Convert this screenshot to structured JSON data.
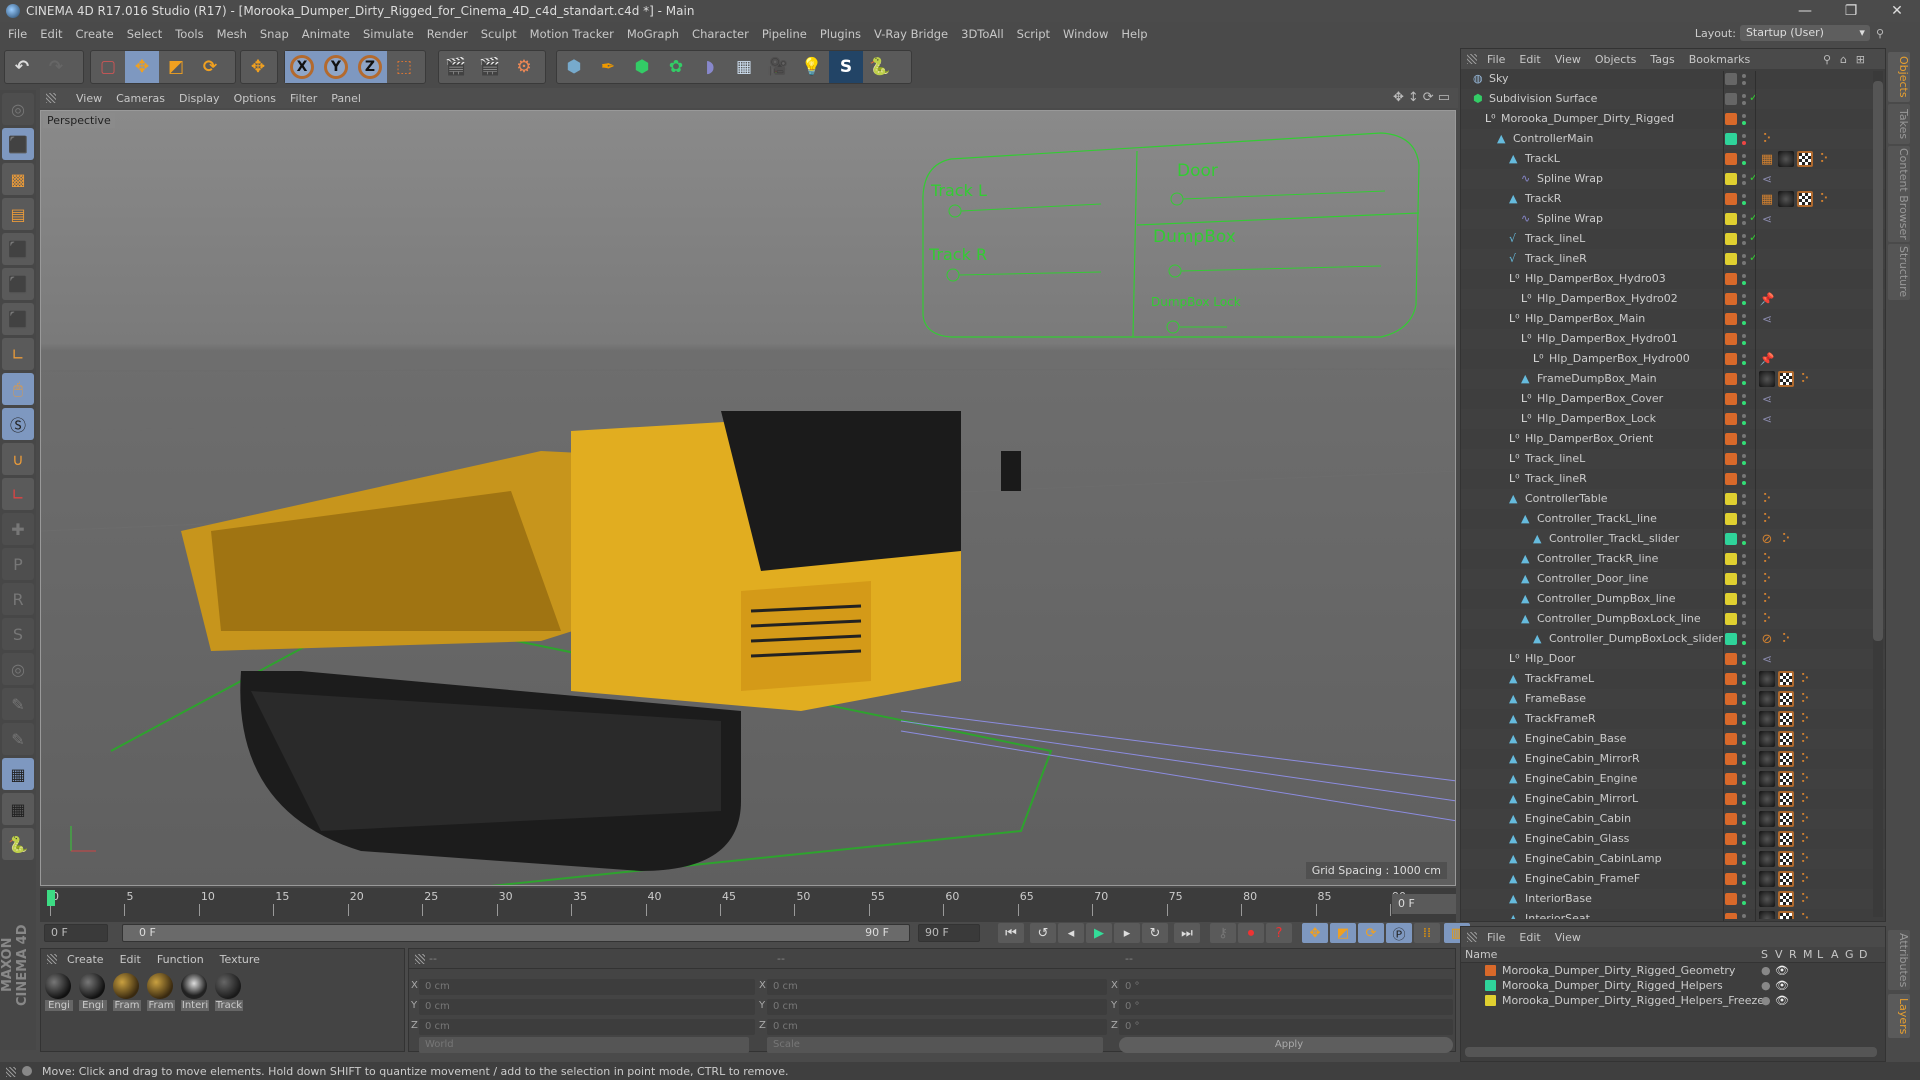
{
  "window": {
    "title": "CINEMA 4D R17.016 Studio (R17) - [Morooka_Dumper_Dirty_Rigged_for_Cinema_4D_c4d_standart.c4d *] - Main",
    "minimize": "—",
    "maximize": "❐",
    "close": "✕"
  },
  "menu": [
    "File",
    "Edit",
    "Create",
    "Select",
    "Tools",
    "Mesh",
    "Snap",
    "Animate",
    "Simulate",
    "Render",
    "Sculpt",
    "Motion Tracker",
    "MoGraph",
    "Character",
    "Pipeline",
    "Plugins",
    "V-Ray Bridge",
    "3DToAll",
    "Script",
    "Window",
    "Help"
  ],
  "layout": {
    "label": "Layout:",
    "value": "Startup (User)"
  },
  "toolbar": {
    "undo": "↶",
    "redo": "↷",
    "x": "X",
    "y": "Y",
    "z": "Z"
  },
  "viewport": {
    "menu": [
      "View",
      "Cameras",
      "Display",
      "Options",
      "Filter",
      "Panel"
    ],
    "camera": "Perspective",
    "grid_spacing": "Grid Spacing : 1000 cm",
    "controls": {
      "track_l": "Track L",
      "track_r": "Track R",
      "door": "Door",
      "dumpbox": "DumpBox",
      "dumpbox_lock": "DumpBox Lock"
    }
  },
  "timeline": {
    "ticks": [
      "0",
      "5",
      "10",
      "15",
      "20",
      "25",
      "30",
      "35",
      "40",
      "45",
      "50",
      "55",
      "60",
      "65",
      "70",
      "75",
      "80",
      "85",
      "90"
    ],
    "current_frame_right": "0 F",
    "start_field": "0 F",
    "range_start": "0 F",
    "range_end": "90 F",
    "end_field": "90 F",
    "current_frame": 0,
    "max_frame": 90
  },
  "materials": {
    "menu": [
      "Create",
      "Edit",
      "Function",
      "Texture"
    ],
    "items": [
      "Engi",
      "Engi",
      "Fram",
      "Fram",
      "Interi",
      "Track"
    ]
  },
  "coords": {
    "headers": [
      "--",
      "--",
      "--"
    ],
    "position": {
      "x": "0 cm",
      "y": "0 cm",
      "z": "0 cm"
    },
    "size": {
      "x": "0 cm",
      "y": "0 cm",
      "z": "0 cm"
    },
    "rotation": {
      "x": "0 °",
      "y": "0 °",
      "z": "0 °"
    },
    "mode": "World",
    "scale_mode": "Scale",
    "apply": "Apply"
  },
  "status": "Move: Click and drag to move elements. Hold down SHIFT to quantize movement / add to the selection in point mode, CTRL to remove.",
  "objects": {
    "menu": [
      "File",
      "Edit",
      "View",
      "Objects",
      "Tags",
      "Bookmarks"
    ],
    "rows": [
      {
        "name": "Sky",
        "depth": 0,
        "icon": "sky",
        "layer": "none",
        "tags": []
      },
      {
        "name": "Subdivision Surface",
        "depth": 0,
        "icon": "subdiv",
        "layer": "none",
        "check": true,
        "tags": []
      },
      {
        "name": "Morooka_Dumper_Dirty_Rigged",
        "depth": 1,
        "icon": "null",
        "layer": "orange",
        "tags": []
      },
      {
        "name": "ControllerMain",
        "depth": 2,
        "icon": "poly",
        "layer": "green",
        "tags": [
          "ik"
        ]
      },
      {
        "name": "TrackL",
        "depth": 3,
        "icon": "poly",
        "layer": "orange",
        "tags": [
          "wire",
          "mat",
          "tex",
          "ik"
        ]
      },
      {
        "name": "Spline Wrap",
        "depth": 4,
        "icon": "deform",
        "layer": "yellow",
        "check": true,
        "tags": [
          "xp"
        ]
      },
      {
        "name": "TrackR",
        "depth": 3,
        "icon": "poly",
        "layer": "orange",
        "tags": [
          "wire",
          "mat",
          "tex",
          "ik"
        ]
      },
      {
        "name": "Spline Wrap",
        "depth": 4,
        "icon": "deform",
        "layer": "yellow",
        "check": true,
        "tags": [
          "xp"
        ]
      },
      {
        "name": "Track_lineL",
        "depth": 3,
        "icon": "spline",
        "layer": "yellow",
        "check": true,
        "tags": []
      },
      {
        "name": "Track_lineR",
        "depth": 3,
        "icon": "spline",
        "layer": "yellow",
        "check": true,
        "tags": []
      },
      {
        "name": "Hlp_DamperBox_Hydro03",
        "depth": 3,
        "icon": "null",
        "layer": "orange",
        "tags": []
      },
      {
        "name": "Hlp_DamperBox_Hydro02",
        "depth": 4,
        "icon": "null",
        "layer": "orange",
        "tags": [
          "pin"
        ]
      },
      {
        "name": "Hlp_DamperBox_Main",
        "depth": 3,
        "icon": "null",
        "layer": "orange",
        "tags": [
          "xp"
        ]
      },
      {
        "name": "Hlp_DamperBox_Hydro01",
        "depth": 4,
        "icon": "null",
        "layer": "orange",
        "tags": []
      },
      {
        "name": "Hlp_DamperBox_Hydro00",
        "depth": 5,
        "icon": "null",
        "layer": "orange",
        "tags": [
          "pin"
        ]
      },
      {
        "name": "FrameDumpBox_Main",
        "depth": 4,
        "icon": "poly",
        "layer": "orange",
        "tags": [
          "mat",
          "tex",
          "ik"
        ]
      },
      {
        "name": "Hlp_DamperBox_Cover",
        "depth": 4,
        "icon": "null",
        "layer": "orange",
        "tags": [
          "xp"
        ]
      },
      {
        "name": "Hlp_DamperBox_Lock",
        "depth": 4,
        "icon": "null",
        "layer": "orange",
        "tags": [
          "xp"
        ]
      },
      {
        "name": "Hlp_DamperBox_Orient",
        "depth": 3,
        "icon": "null",
        "layer": "orange",
        "tags": []
      },
      {
        "name": "Track_lineL",
        "depth": 3,
        "icon": "null",
        "layer": "orange",
        "tags": []
      },
      {
        "name": "Track_lineR",
        "depth": 3,
        "icon": "null",
        "layer": "orange",
        "tags": []
      },
      {
        "name": "ControllerTable",
        "depth": 3,
        "icon": "poly",
        "layer": "yellow",
        "tags": [
          "ik"
        ]
      },
      {
        "name": "Controller_TrackL_line",
        "depth": 4,
        "icon": "poly",
        "layer": "yellow",
        "tags": [
          "ik"
        ]
      },
      {
        "name": "Controller_TrackL_slider",
        "depth": 5,
        "icon": "poly",
        "layer": "green",
        "tags": [
          "prot",
          "ik"
        ]
      },
      {
        "name": "Controller_TrackR_line",
        "depth": 4,
        "icon": "poly",
        "layer": "yellow",
        "tags": [
          "ik"
        ]
      },
      {
        "name": "Controller_Door_line",
        "depth": 4,
        "icon": "poly",
        "layer": "yellow",
        "tags": [
          "ik"
        ]
      },
      {
        "name": "Controller_DumpBox_line",
        "depth": 4,
        "icon": "poly",
        "layer": "yellow",
        "tags": [
          "ik"
        ]
      },
      {
        "name": "Controller_DumpBoxLock_line",
        "depth": 4,
        "icon": "poly",
        "layer": "yellow",
        "tags": [
          "ik"
        ]
      },
      {
        "name": "Controller_DumpBoxLock_slider",
        "depth": 5,
        "icon": "poly",
        "layer": "green",
        "tags": [
          "prot",
          "ik"
        ]
      },
      {
        "name": "Hlp_Door",
        "depth": 3,
        "icon": "null",
        "layer": "orange",
        "tags": [
          "xp"
        ]
      },
      {
        "name": "TrackFrameL",
        "depth": 3,
        "icon": "poly",
        "layer": "orange",
        "tags": [
          "mat",
          "tex",
          "ik"
        ]
      },
      {
        "name": "FrameBase",
        "depth": 3,
        "icon": "poly",
        "layer": "orange",
        "tags": [
          "mat",
          "tex",
          "ik"
        ]
      },
      {
        "name": "TrackFrameR",
        "depth": 3,
        "icon": "poly",
        "layer": "orange",
        "tags": [
          "mat",
          "tex",
          "ik"
        ]
      },
      {
        "name": "EngineCabin_Base",
        "depth": 3,
        "icon": "poly",
        "layer": "orange",
        "tags": [
          "mat",
          "tex",
          "ik"
        ]
      },
      {
        "name": "EngineCabin_MirrorR",
        "depth": 3,
        "icon": "poly",
        "layer": "orange",
        "tags": [
          "mat",
          "tex",
          "ik"
        ]
      },
      {
        "name": "EngineCabin_Engine",
        "depth": 3,
        "icon": "poly",
        "layer": "orange",
        "tags": [
          "mat",
          "tex",
          "ik"
        ]
      },
      {
        "name": "EngineCabin_MirrorL",
        "depth": 3,
        "icon": "poly",
        "layer": "orange",
        "tags": [
          "mat",
          "tex",
          "ik"
        ]
      },
      {
        "name": "EngineCabin_Cabin",
        "depth": 3,
        "icon": "poly",
        "layer": "orange",
        "tags": [
          "mat",
          "tex",
          "ik"
        ]
      },
      {
        "name": "EngineCabin_Glass",
        "depth": 3,
        "icon": "poly",
        "layer": "orange",
        "tags": [
          "mat",
          "tex",
          "ik"
        ]
      },
      {
        "name": "EngineCabin_CabinLamp",
        "depth": 3,
        "icon": "poly",
        "layer": "orange",
        "tags": [
          "mat",
          "tex",
          "ik"
        ]
      },
      {
        "name": "EngineCabin_FrameF",
        "depth": 3,
        "icon": "poly",
        "layer": "orange",
        "tags": [
          "mat",
          "tex",
          "ik"
        ]
      },
      {
        "name": "InteriorBase",
        "depth": 3,
        "icon": "poly",
        "layer": "orange",
        "tags": [
          "mat",
          "tex",
          "ik"
        ]
      },
      {
        "name": "InteriorSeat",
        "depth": 3,
        "icon": "poly",
        "layer": "orange",
        "tags": [
          "mat",
          "tex",
          "ik"
        ]
      }
    ]
  },
  "layers": {
    "menu": [
      "File",
      "Edit",
      "View"
    ],
    "columns": [
      "Name",
      "S",
      "V",
      "R",
      "M",
      "L",
      "A",
      "G",
      "D"
    ],
    "rows": [
      {
        "name": "Morooka_Dumper_Dirty_Rigged_Geometry",
        "color": "#d9692a"
      },
      {
        "name": "Morooka_Dumper_Dirty_Rigged_Helpers",
        "color": "#2fd39a"
      },
      {
        "name": "Morooka_Dumper_Dirty_Rigged_Helpers_Freeze",
        "color": "#e0d030"
      }
    ]
  },
  "side_tabs": {
    "objects": "Objects",
    "takes": "Takes",
    "content": "Content Browser",
    "structure": "Structure",
    "attributes": "Attributes",
    "layers": "Layers"
  },
  "layer_colors": {
    "orange": "#d9692a",
    "green": "#2fd39a",
    "yellow": "#e0d030",
    "none": "#666666"
  },
  "branding": "MAXON CINEMA 4D"
}
